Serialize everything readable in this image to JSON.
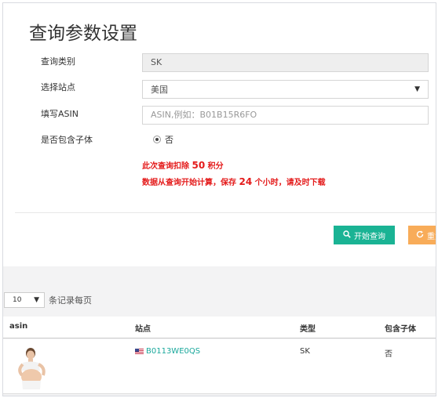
{
  "form": {
    "title": "查询参数设置",
    "fields": {
      "query_type": {
        "label": "查询类别",
        "value": "SK"
      },
      "site": {
        "label": "选择站点",
        "value": "美国"
      },
      "asin": {
        "label": "填写ASIN",
        "placeholder": "ASIN,例如：B01B15R6FO"
      },
      "include_children": {
        "label": "是否包含子体",
        "option_label": "否"
      }
    },
    "notice_points": {
      "prefix": "此次查询扣除",
      "value": "50",
      "suffix": "积分"
    },
    "notice_validity": {
      "prefix": "数据从查询开始计算，保存",
      "value": "24",
      "suffix": "个小时，请及时下载"
    },
    "buttons": {
      "query": "开始查询",
      "reset": "重置"
    }
  },
  "pagination": {
    "page_size": "10",
    "page_size_label": "条记录每页"
  },
  "table": {
    "headers": {
      "asin": "asin",
      "site": "站点",
      "type": "类型",
      "include_children": "包含子体"
    },
    "rows": [
      {
        "asin_link": "B0113WE0QS",
        "type": "SK",
        "include_children": "否",
        "flag_icon": "us-flag-icon"
      }
    ]
  },
  "colors": {
    "query_button": "#1ab394",
    "reset_button": "#f8ac59",
    "notice_text": "#e41b1b",
    "link": "#1aa89c"
  }
}
